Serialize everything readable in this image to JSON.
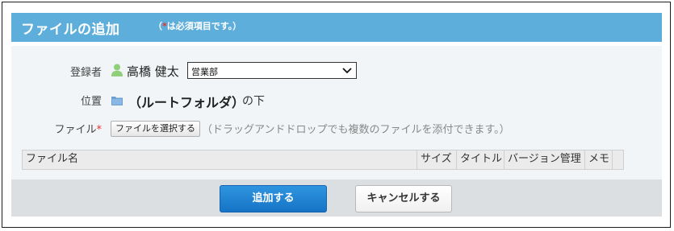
{
  "header": {
    "title": "ファイルの追加",
    "note_open": "（",
    "note_asterisk": "*",
    "note_text": "は必須項目です。）"
  },
  "form": {
    "registrant": {
      "label": "登録者",
      "user_icon": "user-icon",
      "user_name": "高橋 健太",
      "group_selected": "営業部"
    },
    "location": {
      "label": "位置",
      "folder_icon": "folder-icon",
      "folder_name": "（ルートフォルダ）",
      "suffix": "の下"
    },
    "file": {
      "label": "ファイル",
      "required_mark": "*",
      "select_button": "ファイルを選択する",
      "drop_hint": "（ドラッグアンドドロップでも複数のファイルを添付できます。）"
    },
    "table": {
      "columns": [
        "ファイル名",
        "サイズ",
        "タイトル",
        "バージョン管理",
        "メモ"
      ]
    }
  },
  "footer": {
    "add_button": "追加する",
    "cancel_button": "キャンセルする"
  },
  "colors": {
    "header_bg": "#5eaedb",
    "required": "#e8322c",
    "primary_button": "#1a7ccf"
  }
}
